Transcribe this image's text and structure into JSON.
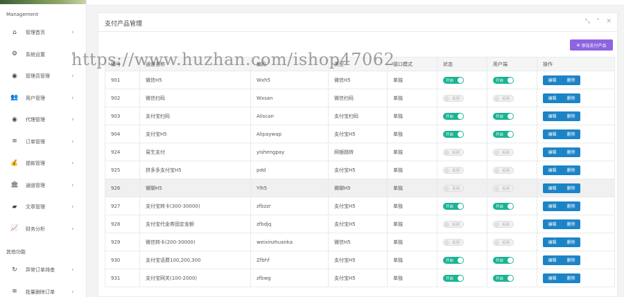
{
  "sidebar": {
    "section_management": "Management",
    "items": [
      {
        "label": "管理首页",
        "icon": "home-icon"
      },
      {
        "label": "系统设置",
        "icon": "gears-icon"
      },
      {
        "label": "管理员管理",
        "icon": "user-circle-icon"
      },
      {
        "label": "用户管理",
        "icon": "users-icon"
      },
      {
        "label": "代理管理",
        "icon": "user-circle-icon"
      },
      {
        "label": "订单管理",
        "icon": "list-icon"
      },
      {
        "label": "提款管理",
        "icon": "money-bag-icon"
      },
      {
        "label": "通道管理",
        "icon": "bank-icon"
      },
      {
        "label": "文章管理",
        "icon": "book-icon"
      },
      {
        "label": "财务分析",
        "icon": "chart-icon"
      }
    ],
    "section_other": "其他功能",
    "other_items": [
      {
        "label": "异常订单排查",
        "icon": "refresh-icon"
      },
      {
        "label": "批量删除订单",
        "icon": "list-icon"
      }
    ]
  },
  "panel": {
    "title": "支付产品管理",
    "add_button": "添加支付产品",
    "tools": {
      "expand": "⤡",
      "collapse": "⌃",
      "close": "✕"
    }
  },
  "table": {
    "headers": [
      "编号",
      "通道名称",
      "编码",
      "类型",
      "接口模式",
      "状态",
      "用户端",
      "操作"
    ],
    "rows": [
      {
        "id": "901",
        "name": "微信H5",
        "code": "Wxh5",
        "type": "微信H5",
        "mode": "单独",
        "status": "开启",
        "client": "开启"
      },
      {
        "id": "902",
        "name": "微信扫码",
        "code": "Wxsan",
        "type": "微信扫码",
        "mode": "单独",
        "status": "关闭",
        "client": "关闭"
      },
      {
        "id": "903",
        "name": "支付宝扫码",
        "code": "Aliscan",
        "type": "支付宝扫码",
        "mode": "单独",
        "status": "开启",
        "client": "开启"
      },
      {
        "id": "904",
        "name": "支付宝H5",
        "code": "Alipaywap",
        "type": "支付宝H5",
        "mode": "单独",
        "status": "开启",
        "client": "开启"
      },
      {
        "id": "924",
        "name": "易生支付",
        "code": "yishengpay",
        "type": "网银跳转",
        "mode": "单独",
        "status": "关闭",
        "client": "关闭"
      },
      {
        "id": "925",
        "name": "拼多多支付宝H5",
        "code": "pdd",
        "type": "支付宝H5",
        "mode": "单独",
        "status": "关闭",
        "client": "关闭"
      },
      {
        "id": "926",
        "name": "微聊H5",
        "code": "Ylh5",
        "type": "微聊H5",
        "mode": "单独",
        "status": "关闭",
        "client": "关闭"
      },
      {
        "id": "927",
        "name": "支付宝转卡(300-30000)",
        "code": "zfbzzr",
        "type": "支付宝H5",
        "mode": "单独",
        "status": "开启",
        "client": "开启"
      },
      {
        "id": "928",
        "name": "支付宝代金券固定金额",
        "code": "zfbdjq",
        "type": "支付宝H5",
        "mode": "单独",
        "status": "关闭",
        "client": "关闭"
      },
      {
        "id": "929",
        "name": "微信转卡(200-30000)",
        "code": "weixinzhuanka",
        "type": "微信H5",
        "mode": "单独",
        "status": "关闭",
        "client": "关闭"
      },
      {
        "id": "930",
        "name": "支付宝话费100,200,300",
        "code": "Zfbhf",
        "type": "支付宝H5",
        "mode": "单独",
        "status": "开启",
        "client": "开启"
      },
      {
        "id": "931",
        "name": "支付宝网关(100-2000)",
        "code": "zfbwg",
        "type": "支付宝H5",
        "mode": "单独",
        "status": "开启",
        "client": "开启"
      }
    ],
    "edit_label": "编辑",
    "delete_label": "删除"
  },
  "watermark": "https://www.huzhan.com/ishop47062",
  "colors": {
    "toggle_on": "#1ab394",
    "ops_button": "#1c84c6",
    "add_button": "#8e64e0"
  }
}
